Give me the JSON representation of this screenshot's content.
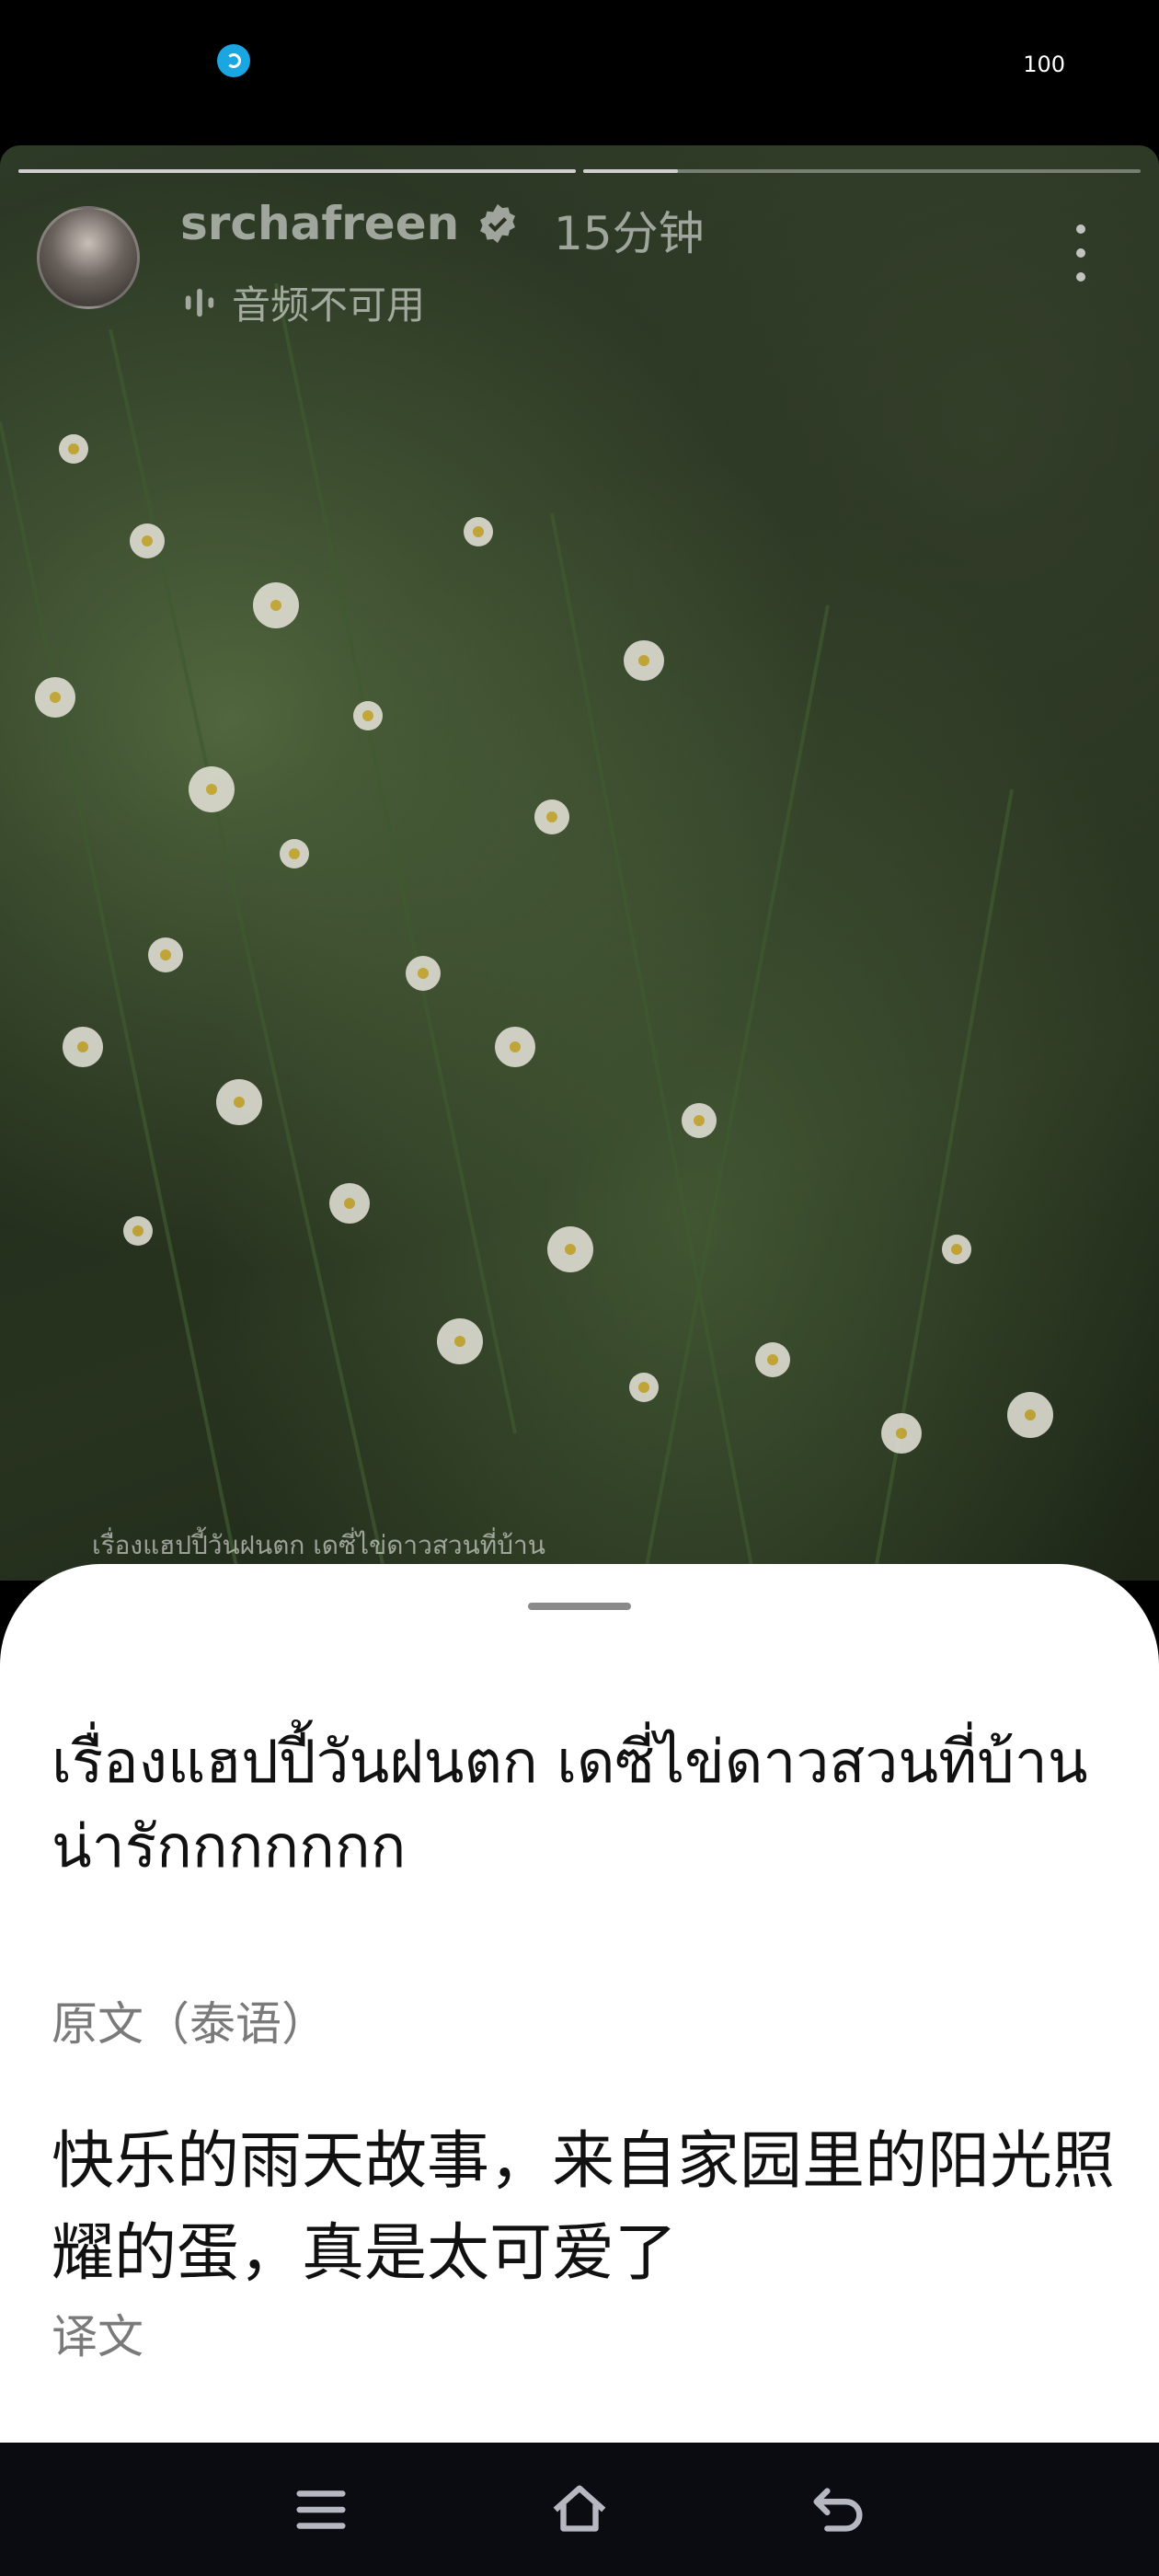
{
  "status_bar": {
    "app_icon": "browser-swirl-icon",
    "battery": "100"
  },
  "story": {
    "username": "srchafreen",
    "time_ago": "15分钟",
    "audio_status": "音频不可用",
    "caption": "เรื่องแฮปปี้วันฝนตก เดซี่ไข่ดาวสวนที่บ้าน",
    "progress": [
      1.0,
      0.17
    ],
    "icons": [
      "verified-icon",
      "audio-bars-icon",
      "more-vert-icon"
    ]
  },
  "sheet": {
    "original_text": "เรื่องแฮปปี้วันฝนตก เดซี่ไข่ดาวสวนที่บ้าน\n น่ารักกกกกกก",
    "original_label": "原文（泰语）",
    "translation_text": "快乐的雨天故事，来自家园里的阳光照耀的蛋，真是太可爱了",
    "translation_label": "译文"
  },
  "nav_bar": {
    "icons": [
      "menu-icon",
      "home-icon",
      "back-icon"
    ]
  },
  "colors": {
    "sheet_bg": "#ffffff",
    "nav_bg": "#0a0c12",
    "label_gray": "#7a7a7a"
  }
}
